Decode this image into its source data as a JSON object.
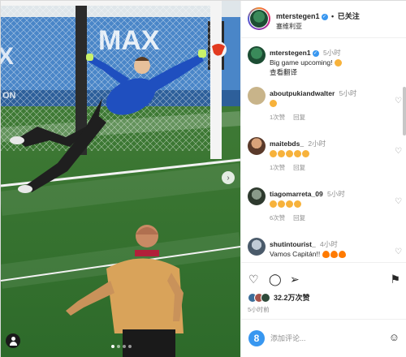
{
  "header": {
    "username": "mterstegen1",
    "separator": "•",
    "follow_status": "已关注",
    "location": "塞维利亚"
  },
  "caption": {
    "username": "mterstegen1",
    "time": "5小时",
    "text": "Big game upcoming!",
    "translate": "查看翻译"
  },
  "comments": [
    {
      "username": "aboutpukiandwalter",
      "time": "5小时",
      "text": "",
      "likes": "1次赞",
      "reply": "回复",
      "avatar_color": "#c8b48a"
    },
    {
      "username": "maitebds_",
      "time": "2小时",
      "text": "",
      "likes": "1次赞",
      "reply": "回复",
      "avatar_color": "#5a3a2a"
    },
    {
      "username": "tiagomarreta_09",
      "time": "5小时",
      "text": "",
      "likes": "6次赞",
      "reply": "回复",
      "avatar_color": "#4a5a4a"
    },
    {
      "username": "shutintourist_",
      "time": "4小时",
      "text": "Vamos Capitán!!",
      "likes": "",
      "reply": "",
      "avatar_color": "#6a7a8a"
    }
  ],
  "actions": {
    "likes_count": "32.2万次赞",
    "post_time": "5小时前"
  },
  "add_comment": {
    "placeholder": "添加评论..."
  },
  "colors": {
    "accent": "#3897f0",
    "pitch": "#2f6a2f",
    "keeper_shirt": "#1f4fbf"
  }
}
